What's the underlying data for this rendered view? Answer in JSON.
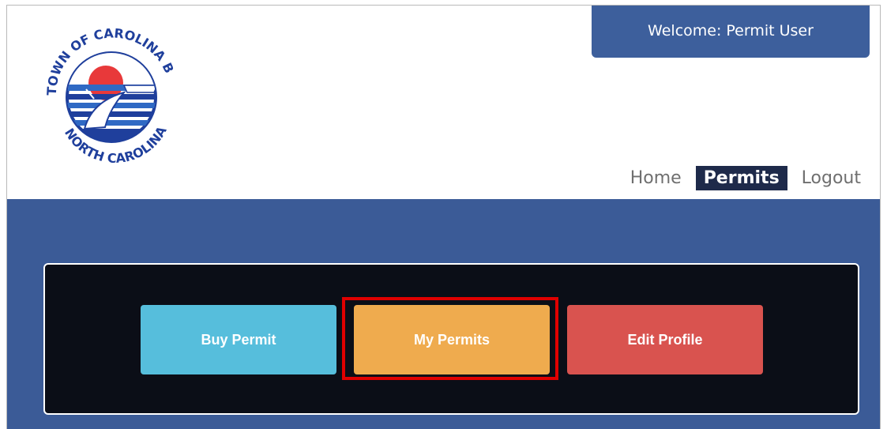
{
  "header": {
    "logo": {
      "top_text": "TOWN OF CAROLINA BEACH",
      "bottom_text": "NORTH CAROLINA"
    },
    "welcome_text": "Welcome:  Permit User",
    "nav": [
      {
        "label": "Home",
        "active": false
      },
      {
        "label": "Permits",
        "active": true
      },
      {
        "label": "Logout",
        "active": false
      }
    ]
  },
  "main": {
    "buttons": [
      {
        "label": "Buy Permit",
        "color": "#56bedc"
      },
      {
        "label": "My Permits",
        "color": "#efab4e",
        "highlighted": true
      },
      {
        "label": "Edit Profile",
        "color": "#d9534f"
      }
    ]
  },
  "colors": {
    "brand_blue": "#3b5b97",
    "nav_active": "#1e2a4a",
    "panel_bg": "#0b0e17",
    "highlight": "#e00000"
  }
}
